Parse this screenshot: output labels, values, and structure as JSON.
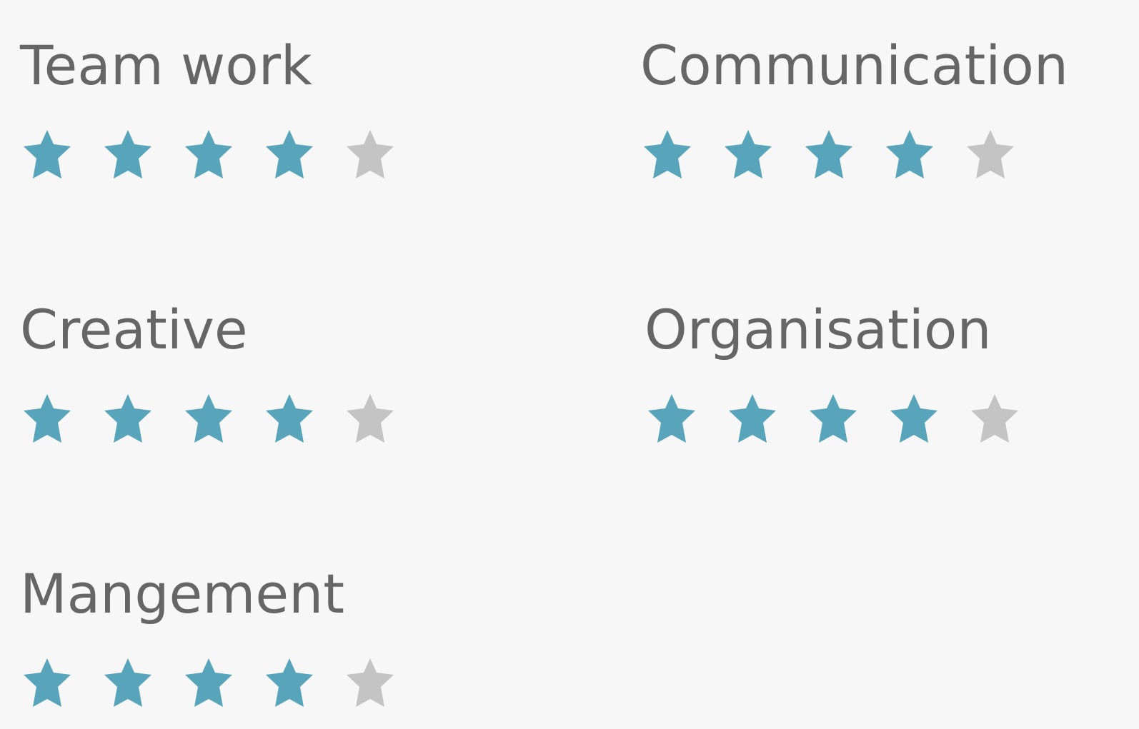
{
  "colors": {
    "background": "#f7f7f7",
    "text": "#666666",
    "star_filled": "#58a4bb",
    "star_empty": "#c4c4c4"
  },
  "icons": {
    "filled_star": "star-filled-icon",
    "empty_star": "star-empty-icon"
  },
  "skills": [
    {
      "title": "Team work",
      "rating": 4,
      "max_rating": 5
    },
    {
      "title": "Communication",
      "rating": 4,
      "max_rating": 5
    },
    {
      "title": "Creative",
      "rating": 4,
      "max_rating": 5
    },
    {
      "title": "Organisation",
      "rating": 4,
      "max_rating": 5
    },
    {
      "title": "Mangement",
      "rating": 4,
      "max_rating": 5
    }
  ]
}
